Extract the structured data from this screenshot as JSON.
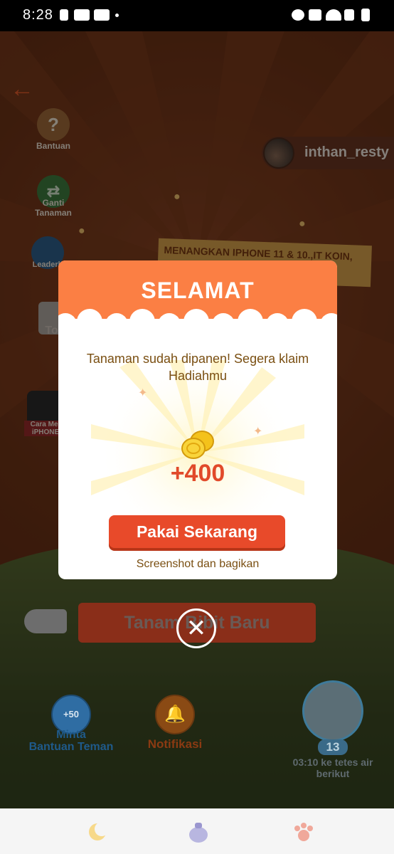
{
  "status_bar": {
    "time": "8:28"
  },
  "game": {
    "user_name": "inthan_resty",
    "side_buttons": [
      {
        "label": "Bantuan"
      },
      {
        "label": "Ganti\nTanaman"
      },
      {
        "label": "Leaderb"
      },
      {
        "label": "Tok"
      },
      {
        "label": "Cara Mer\niPHONE"
      }
    ],
    "banner_text": "MENANGKAN IPHONE 11 & 10.,IT KOIN,",
    "plant_button": "Tanam Bibit Baru",
    "help_button": {
      "badge": "+50",
      "label": "Minta\nBantuan Teman"
    },
    "notif_button": {
      "label": "Notifikasi"
    },
    "water": {
      "count": "13",
      "label": "03:10 ke tetes air\nberikut"
    }
  },
  "dialog": {
    "title": "SELAMAT",
    "message": "Tanaman sudah dipanen! Segera klaim Hadiahmu",
    "reward": "+400",
    "claim_button": "Pakai Sekarang",
    "share_text": "Screenshot dan bagikan"
  },
  "colors": {
    "accent": "#fb7f44",
    "button": "#e84a2a",
    "reward": "#e14a2a",
    "text_brown": "#7a4f12"
  }
}
